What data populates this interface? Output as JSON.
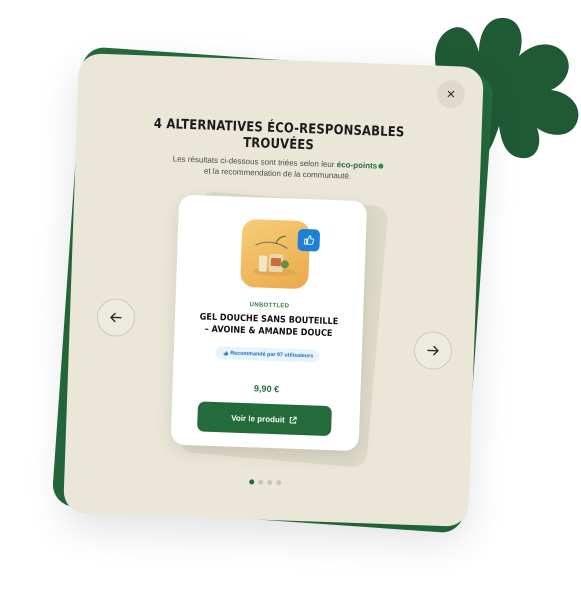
{
  "modal": {
    "title_line1": "4 ALTERNATIVES ÉCO-RESPONSABLES",
    "title_line2": "TROUVÉES",
    "subtitle_before": "Les résultats ci-dessous sont triées selon leur",
    "subtitle_eco": "éco-points",
    "subtitle_after": "et la recommendation de la communauté.",
    "close_label": "×"
  },
  "product": {
    "brand": "UNBOTTLED",
    "name_line1": "GEL DOUCHE SANS BOUTEILLE",
    "name_line2": "– AVOINE & AMANDE DOUCE",
    "recommendation": "Recommandé par 97 utilisateurs",
    "price": "9,90 €",
    "cta_label": "Voir le produit"
  },
  "carousel": {
    "total": 4,
    "active_index": 0
  },
  "colors": {
    "brand_green": "#246b3c",
    "card_beige": "#eae7d9",
    "badge_blue": "#1e7fd8"
  },
  "icons": {
    "close": "close-icon",
    "prev": "arrow-left-icon",
    "next": "arrow-right-icon",
    "badge": "thumbs-up-icon",
    "external": "external-link-icon"
  }
}
